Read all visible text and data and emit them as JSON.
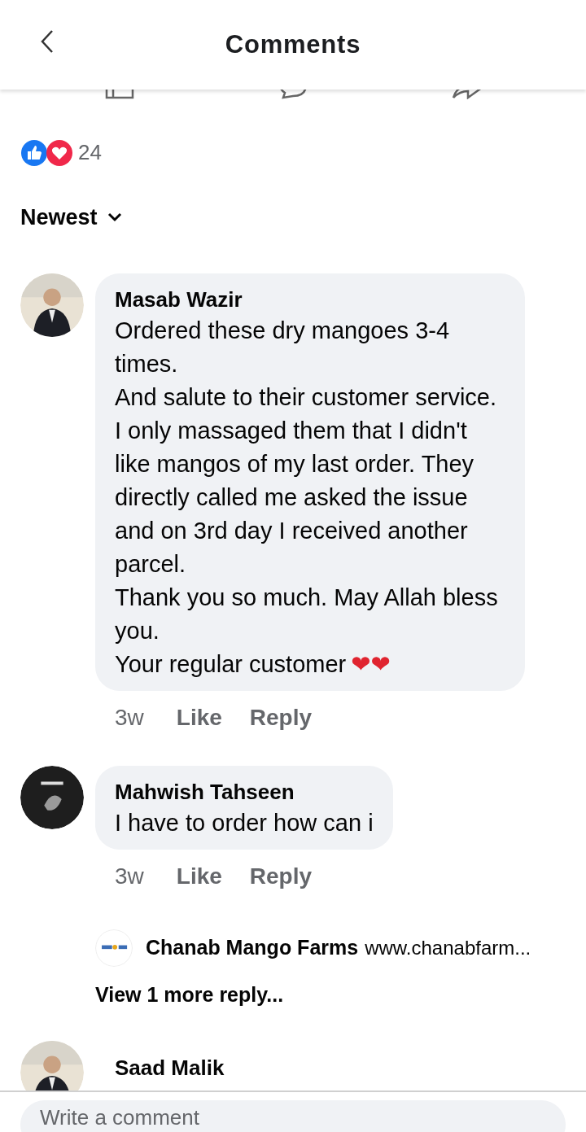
{
  "header": {
    "title": "Comments"
  },
  "reactions": {
    "count": "24"
  },
  "sort": {
    "label": "Newest"
  },
  "comments": [
    {
      "author": "Masab Wazir",
      "lines": [
        "Ordered these dry mangoes 3-4 times.",
        "And salute to their customer service.",
        "I only massaged them that I didn't like mangos of my last order. They directly called me asked the issue and on 3rd day I received another parcel.",
        "Thank you so much. May Allah bless you.",
        "Your regular customer"
      ],
      "emoji": "❤❤",
      "time": "3w",
      "like": "Like",
      "reply": "Reply"
    },
    {
      "author": "Mahwish Tahseen",
      "lines": [
        "I have to order how can i"
      ],
      "time": "3w",
      "like": "Like",
      "reply": "Reply",
      "replies": [
        {
          "author": "Chanab Mango Farms",
          "text": "www.chanabfarm..."
        }
      ],
      "more_replies": "View 1 more reply..."
    },
    {
      "author": "Saad Malik"
    }
  ],
  "composer": {
    "placeholder": "Write a comment"
  }
}
